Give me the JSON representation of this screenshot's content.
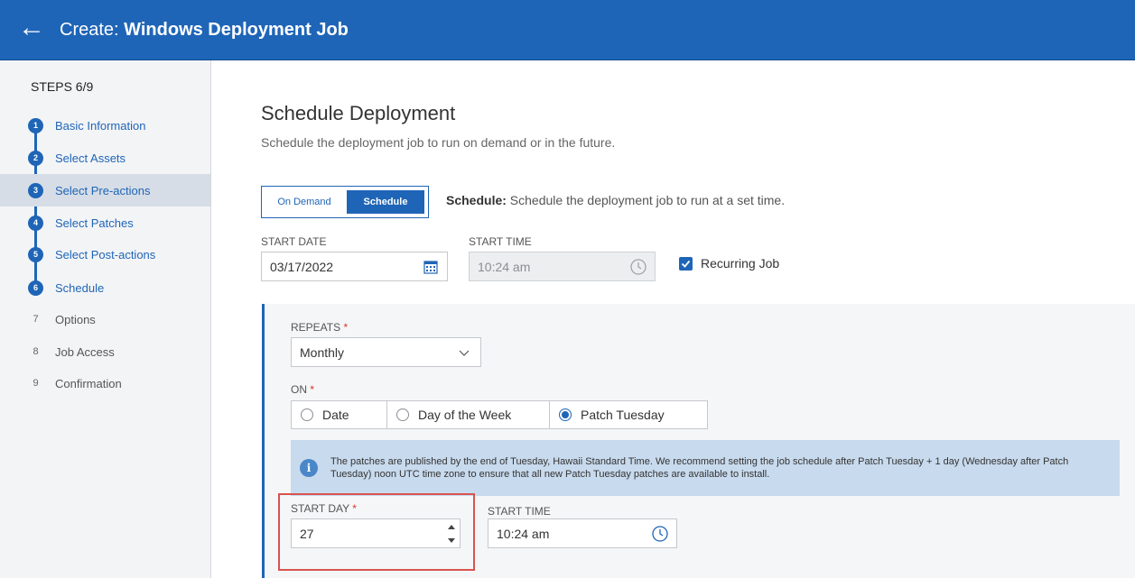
{
  "header": {
    "back_icon": "arrow-left-icon",
    "title_prefix": "Create:",
    "title_bold": "Windows Deployment Job"
  },
  "sidebar": {
    "steps_label": "STEPS 6/9",
    "steps": [
      {
        "num": "1",
        "label": "Basic Information",
        "state": "done"
      },
      {
        "num": "2",
        "label": "Select Assets",
        "state": "done"
      },
      {
        "num": "3",
        "label": "Select Pre-actions",
        "state": "done"
      },
      {
        "num": "4",
        "label": "Select Patches",
        "state": "done"
      },
      {
        "num": "5",
        "label": "Select Post-actions",
        "state": "done"
      },
      {
        "num": "6",
        "label": "Schedule",
        "state": "done"
      },
      {
        "num": "7",
        "label": "Options",
        "state": "todo"
      },
      {
        "num": "8",
        "label": "Job Access",
        "state": "todo"
      },
      {
        "num": "9",
        "label": "Confirmation",
        "state": "todo"
      }
    ]
  },
  "main": {
    "title": "Schedule Deployment",
    "subtitle": "Schedule the deployment job to run on demand or in the future.",
    "toggle": {
      "on_demand_label": "On Demand",
      "schedule_label": "Schedule",
      "selected": "Schedule"
    },
    "schedule_desc_bold": "Schedule:",
    "schedule_desc": "Schedule the deployment job to run at a set time.",
    "start_date_label": "START DATE",
    "start_date_value": "03/17/2022",
    "start_time_label": "START TIME",
    "start_time_value": "10:24 am",
    "recurring_label": "Recurring Job",
    "recurring_checked": true,
    "recurring": {
      "repeats_label": "REPEATS",
      "repeats_value": "Monthly",
      "on_label": "ON",
      "required_mark": "*",
      "on_options": [
        "Date",
        "Day of the Week",
        "Patch Tuesday"
      ],
      "on_selected": "Patch Tuesday",
      "info_text": "The patches are published by the end of Tuesday, Hawaii Standard Time. We recommend setting the job schedule after Patch Tuesday + 1 day (Wednesday after Patch Tuesday) noon UTC time zone to ensure that all new Patch Tuesday patches are available to install.",
      "start_day_label": "START DAY",
      "start_day_value": "27",
      "start_time_label": "START TIME",
      "start_time_value": "10:24 am"
    }
  },
  "colors": {
    "primary": "#1f65b7",
    "info_bg": "#c8daed",
    "highlight": "#d9534f",
    "required": "#d9342b"
  }
}
